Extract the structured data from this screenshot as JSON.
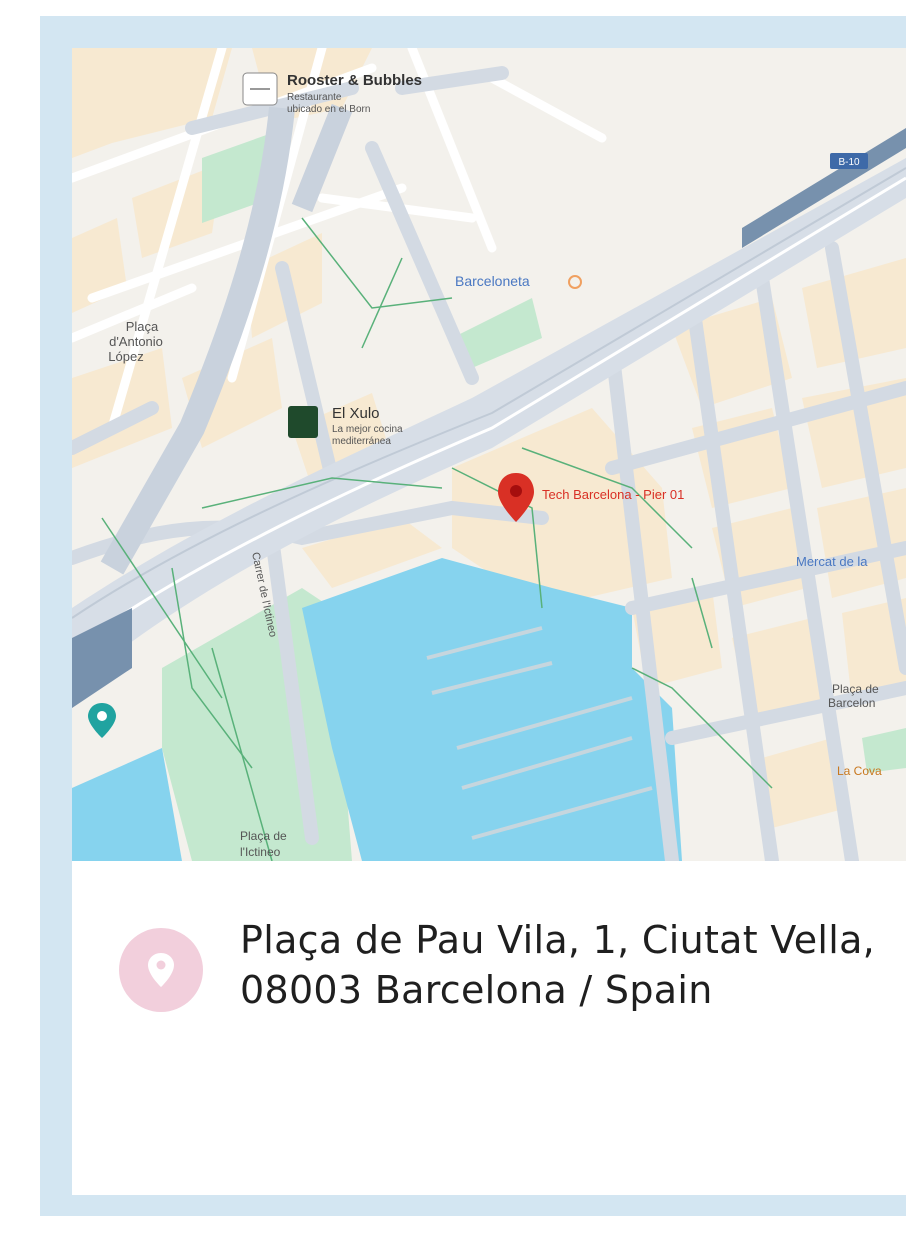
{
  "map": {
    "places": {
      "rooster_name": "Rooster & Bubbles",
      "rooster_desc_1": "Restaurante",
      "rooster_desc_2": "ubicado en el Born",
      "barceloneta": "Barceloneta",
      "placa_antonio_1": "Plaça",
      "placa_antonio_2": "d'Antonio",
      "placa_antonio_3": "López",
      "el_xulo_name": "El Xulo",
      "el_xulo_desc_1": "La mejor cocina",
      "el_xulo_desc_2": "mediterránea",
      "tech_barcelona": "Tech Barcelona - Pier 01",
      "mercat": "Mercat de la",
      "placa_barcelo_1": "Plaça de",
      "placa_barcelo_2": "Barcelon",
      "la_cova": "La Cova",
      "placa_ictineo_1": "Plaça de",
      "placa_ictineo_2": "l'Ictineo",
      "moll_street": "Carrer de l'Ictineo",
      "road_badge": "B-10"
    },
    "colors": {
      "water": "#86d3ee",
      "park": "#c4e8cf",
      "block": "#f7e9d1",
      "road": "#c9d2dd",
      "highway": "#7791ad",
      "marker": "#d93025"
    }
  },
  "address": {
    "line1": "Plaça de Pau Vila, 1, Ciutat Vella,",
    "line2": "08003 Barcelona / Spain",
    "icon": "location-pin-icon"
  }
}
